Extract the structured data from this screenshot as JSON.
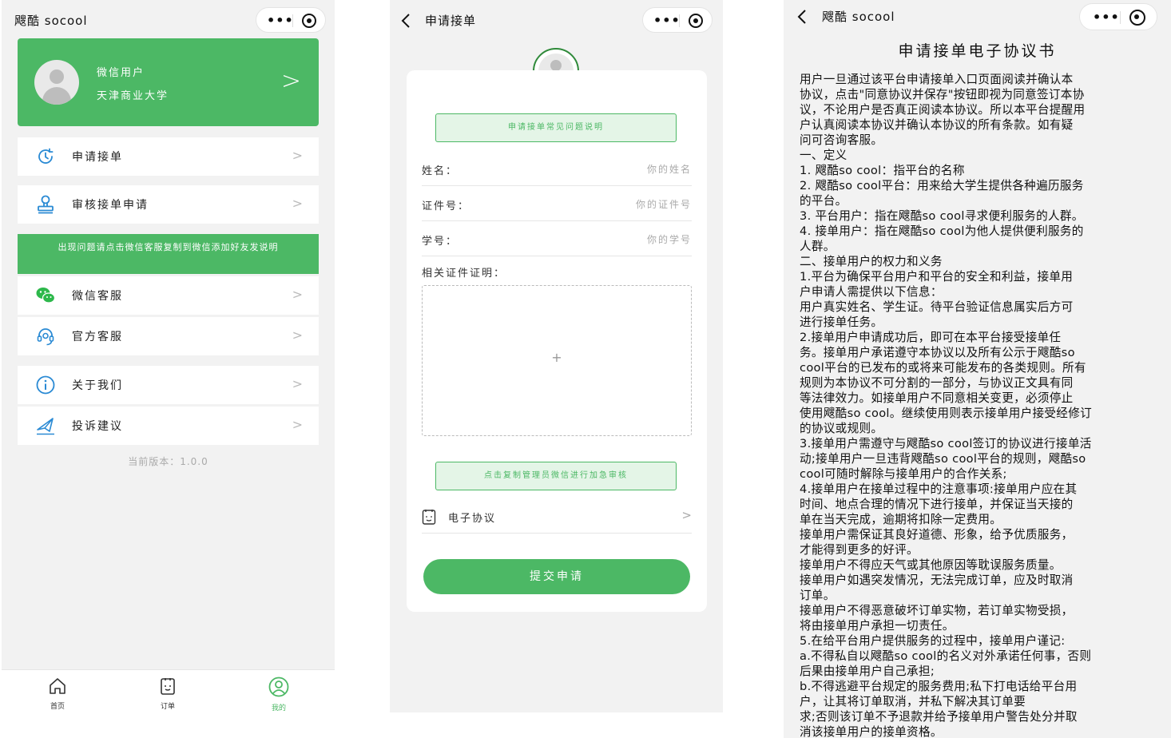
{
  "screen1": {
    "app_title": "飕酷 socool",
    "profile": {
      "nickname": "微信用户",
      "school": "天津商业大学",
      "arrow": ">"
    },
    "menu": [
      {
        "label": "申请接单",
        "icon": "clock-refresh-icon"
      },
      {
        "label": "审核接单申请",
        "icon": "stamp-icon"
      }
    ],
    "notice": "出现问题请点击微信客服复制到微信添加好友发说明",
    "service": [
      {
        "label": "微信客服",
        "icon": "wechat-icon"
      },
      {
        "label": "官方客服",
        "icon": "headset-icon"
      }
    ],
    "about": [
      {
        "label": "关于我们",
        "icon": "info-icon"
      },
      {
        "label": "投诉建议",
        "icon": "paper-plane-icon"
      }
    ],
    "version": "当前版本：1.0.0",
    "tabs": [
      {
        "label": "首页",
        "icon": "home-icon"
      },
      {
        "label": "订单",
        "icon": "order-icon"
      },
      {
        "label": "我的",
        "icon": "profile-icon",
        "active": true
      }
    ]
  },
  "screen2": {
    "title": "申请接单",
    "faq_button": "申请接单常见问题说明",
    "fields": [
      {
        "label": "姓名：",
        "placeholder": "你的姓名"
      },
      {
        "label": "证件号：",
        "placeholder": "你的证件号"
      },
      {
        "label": "学号：",
        "placeholder": "你的学号"
      }
    ],
    "proof_label": "相关证件证明：",
    "upload_plus": "+",
    "copy_admin_button": "点击复制管理员微信进行加急审核",
    "protocol_label": "电子协议",
    "submit_label": "提交申请"
  },
  "screen3": {
    "app_title": "飕酷 socool",
    "doc_title": "申请接单电子协议书",
    "lines": [
      "用户一旦通过该平台申请接单入口页面阅读并确认本",
      "协议，点击\"同意协议并保存\"按钮即视为同意签订本协",
      "议，不论用户是否真正阅读本协议。所以本平台提醒用",
      "户认真阅读本协议并确认本协议的所有条款。如有疑",
      "问可咨询客服。",
      "一、定义",
      "1. 飕酷so cool：指平台的名称",
      "2. 飕酷so cool平台：用来给大学生提供各种遍历服务",
      "的平台。",
      "3. 平台用户：指在飕酷so cool寻求便利服务的人群。",
      "4. 接单用户：指在飕酷so cool为他人提供便利服务的",
      "人群。",
      "二、接单用户的权力和义务",
      "1.平台为确保平台用户和平台的安全和利益，接单用",
      "户申请人需提供以下信息：",
      "用户真实姓名、学生证。待平台验证信息属实后方可",
      "进行接单任务。",
      "2.接单用户申请成功后，即可在本平台接受接单任",
      "务。接单用户承诺遵守本协议以及所有公示于飕酷so",
      "cool平台的已发布的或将来可能发布的各类规则。所有",
      "规则为本协议不可分割的一部分，与协议正文具有同",
      "等法律效力。如接单用户不同意相关变更，必须停止",
      "使用飕酷so cool。继续使用则表示接单用户接受经修订",
      "的协议或规则。",
      "3.接单用户需遵守与飕酷so cool签订的协议进行接单活",
      "动;接单用户一旦违背飕酷so cool平台的规则，飕酷so",
      "cool可随时解除与接单用户的合作关系;",
      "4.接单用户在接单过程中的注意事项:接单用户应在其",
      "时间、地点合理的情况下进行接单，并保证当天接的",
      "单在当天完成，逾期将扣除一定费用。",
      "接单用户需保证其良好道德、形象，给予优质服务，",
      "才能得到更多的好评。",
      "接单用户不得应天气或其他原因等耽误服务质量。",
      "接单用户如遇突发情况，无法完成订单，应及时取消",
      "订单。",
      "接单用户不得恶意破坏订单实物，若订单实物受损，",
      "将由接单用户承担一切责任。",
      "5.在给平台用户提供服务的过程中，接单用户谨记:",
      "a.不得私自以飕酷so cool的名义对外承诺任何事，否则",
      "后果由接单用户自己承担;",
      "b.不得逃避平台规定的服务费用;私下打电话给平台用",
      "户，让其将订单取消，并私下解决其订单要",
      "求;否则该订单不予退款并给予接单用户警告处分并取",
      "消该接单用户的接单资格。"
    ]
  },
  "colors": {
    "accent": "#4cb865",
    "background": "#f2f2f2"
  }
}
